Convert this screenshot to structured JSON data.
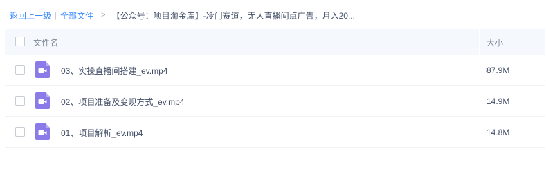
{
  "breadcrumb": {
    "back": "返回上一级",
    "separator": "|",
    "all_files": "全部文件",
    "chevron": ">",
    "current": "【公众号：项目淘金库】-冷门赛道，无人直播间点广告，月入20..."
  },
  "table": {
    "columns": {
      "name": "文件名",
      "size": "大小"
    },
    "rows": [
      {
        "name": "03、实操直播间搭建_ev.mp4",
        "size": "87.9M",
        "icon": "video-file-icon"
      },
      {
        "name": "02、项目准备及变现方式_ev.mp4",
        "size": "14.9M",
        "icon": "video-file-icon"
      },
      {
        "name": "01、项目解析_ev.mp4",
        "size": "14.8M",
        "icon": "video-file-icon"
      }
    ]
  },
  "colors": {
    "link": "#3b8cff",
    "header_bg": "#f5f8fd",
    "video_icon": "#8a7be8"
  }
}
